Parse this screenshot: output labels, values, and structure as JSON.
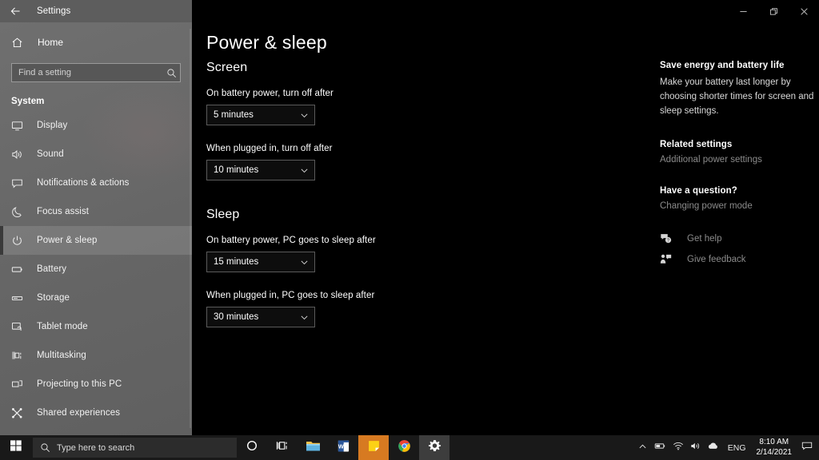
{
  "window": {
    "title": "Settings",
    "back_icon": "back-arrow-icon",
    "minimize_label": "Minimize",
    "restore_label": "Restore",
    "close_label": "Close"
  },
  "sidebar": {
    "home_label": "Home",
    "home_icon": "home-icon",
    "search": {
      "placeholder": "Find a setting",
      "value": "",
      "icon": "search-icon"
    },
    "group_label": "System",
    "items": [
      {
        "label": "Display",
        "icon": "monitor-icon",
        "selected": false
      },
      {
        "label": "Sound",
        "icon": "speaker-icon",
        "selected": false
      },
      {
        "label": "Notifications & actions",
        "icon": "notification-icon",
        "selected": false
      },
      {
        "label": "Focus assist",
        "icon": "moon-icon",
        "selected": false
      },
      {
        "label": "Power & sleep",
        "icon": "power-icon",
        "selected": true
      },
      {
        "label": "Battery",
        "icon": "battery-icon",
        "selected": false
      },
      {
        "label": "Storage",
        "icon": "storage-icon",
        "selected": false
      },
      {
        "label": "Tablet mode",
        "icon": "tablet-icon",
        "selected": false
      },
      {
        "label": "Multitasking",
        "icon": "multitasking-icon",
        "selected": false
      },
      {
        "label": "Projecting to this PC",
        "icon": "projecting-icon",
        "selected": false
      },
      {
        "label": "Shared experiences",
        "icon": "shared-experiences-icon",
        "selected": false
      }
    ]
  },
  "main": {
    "page_title": "Power & sleep",
    "sections": [
      {
        "heading": "Screen",
        "fields": [
          {
            "label": "On battery power, turn off after",
            "value": "5 minutes"
          },
          {
            "label": "When plugged in, turn off after",
            "value": "10 minutes"
          }
        ]
      },
      {
        "heading": "Sleep",
        "fields": [
          {
            "label": "On battery power, PC goes to sleep after",
            "value": "15 minutes"
          },
          {
            "label": "When plugged in, PC goes to sleep after",
            "value": "30 minutes"
          }
        ]
      }
    ]
  },
  "rail": {
    "promo_heading": "Save energy and battery life",
    "promo_body": "Make your battery last longer by choosing shorter times for screen and sleep settings.",
    "related_heading": "Related settings",
    "related_links": [
      {
        "label": "Additional power settings"
      }
    ],
    "question_heading": "Have a question?",
    "question_links": [
      {
        "label": "Changing power mode"
      }
    ],
    "support_links": [
      {
        "label": "Get help",
        "icon": "get-help-icon"
      },
      {
        "label": "Give feedback",
        "icon": "give-feedback-icon"
      }
    ]
  },
  "taskbar": {
    "start_icon": "windows-start-icon",
    "search": {
      "placeholder": "Type here to search",
      "icon": "search-icon"
    },
    "buttons": [
      {
        "name": "cortana",
        "icon": "cortana-circle-icon",
        "state": "normal"
      },
      {
        "name": "task-view",
        "icon": "task-view-icon",
        "state": "normal"
      },
      {
        "name": "file-explorer",
        "icon": "file-explorer-icon",
        "state": "normal"
      },
      {
        "name": "word",
        "icon": "word-icon",
        "state": "normal"
      },
      {
        "name": "sticky-notes",
        "icon": "sticky-notes-icon",
        "state": "active-orange"
      },
      {
        "name": "chrome",
        "icon": "chrome-icon",
        "state": "normal"
      },
      {
        "name": "settings",
        "icon": "gear-icon",
        "state": "active-gray"
      }
    ],
    "tray": {
      "icons": [
        {
          "name": "show-hidden-icons",
          "icon": "chevron-up-icon"
        },
        {
          "name": "battery",
          "icon": "battery-icon"
        },
        {
          "name": "network",
          "icon": "wifi-icon"
        },
        {
          "name": "volume",
          "icon": "speaker-icon"
        },
        {
          "name": "onedrive",
          "icon": "cloud-icon"
        }
      ],
      "language": "ENG",
      "time": "8:10 AM",
      "date": "2/14/2021",
      "notifications_icon": "action-center-icon"
    }
  },
  "colors": {
    "sidebar_bg": "#6a6a6a",
    "content_bg": "#000000",
    "taskbar_bg": "#191919",
    "accent_orange": "#d77a21",
    "muted_text": "#8b8b8b"
  }
}
